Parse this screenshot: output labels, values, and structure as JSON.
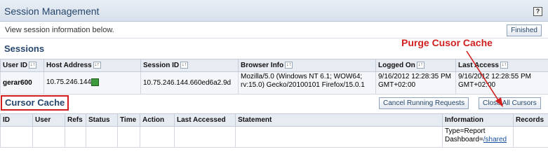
{
  "header": {
    "title": "Session Management",
    "help_label": "?"
  },
  "info": {
    "description": "View session information below.",
    "finished_label": "Finished"
  },
  "sessions": {
    "title": "Sessions",
    "columns": [
      "User ID",
      "Host Address",
      "Session ID",
      "Browser Info",
      "Logged On",
      "Last Access"
    ],
    "row": {
      "user_id": "gerar600",
      "host": "10.75.246.144",
      "session_id": "10.75.246.144.660ed6a2.9d",
      "browser": "Mozilla/5.0 (Windows NT 6.1; WOW64; rv:15.0) Gecko/20100101 Firefox/15.0.1",
      "logged_on": "9/16/2012 12:28:35 PM GMT+02:00",
      "last_access": "9/16/2012 12:28:55 PM GMT+02:00"
    }
  },
  "cursor": {
    "title": "Cursor Cache",
    "cancel_label": "Cancel Running Requests",
    "close_label": "Close All Cursors",
    "columns": [
      "ID",
      "User",
      "Refs",
      "Status",
      "Time",
      "Action",
      "Last Accessed",
      "Statement",
      "Information",
      "Records"
    ],
    "info_line1": "Type=Report",
    "info_line2_prefix": "Dashboard=",
    "info_link": "/shared"
  },
  "annotation": {
    "text": "Purge Cusor Cache",
    "color": "#d11f1f"
  },
  "icons": {
    "sort": "sort-arrows-icon",
    "network": "network-icon",
    "help": "help-icon"
  }
}
